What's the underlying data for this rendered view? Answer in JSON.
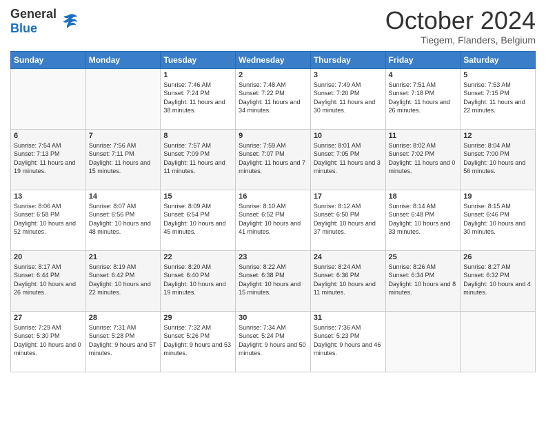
{
  "header": {
    "logo_general": "General",
    "logo_blue": "Blue",
    "title": "October 2024",
    "location": "Tiegem, Flanders, Belgium"
  },
  "weekdays": [
    "Sunday",
    "Monday",
    "Tuesday",
    "Wednesday",
    "Thursday",
    "Friday",
    "Saturday"
  ],
  "weeks": [
    [
      {
        "day": "",
        "sunrise": "",
        "sunset": "",
        "daylight": ""
      },
      {
        "day": "",
        "sunrise": "",
        "sunset": "",
        "daylight": ""
      },
      {
        "day": "1",
        "sunrise": "Sunrise: 7:46 AM",
        "sunset": "Sunset: 7:24 PM",
        "daylight": "Daylight: 11 hours and 38 minutes."
      },
      {
        "day": "2",
        "sunrise": "Sunrise: 7:48 AM",
        "sunset": "Sunset: 7:22 PM",
        "daylight": "Daylight: 11 hours and 34 minutes."
      },
      {
        "day": "3",
        "sunrise": "Sunrise: 7:49 AM",
        "sunset": "Sunset: 7:20 PM",
        "daylight": "Daylight: 11 hours and 30 minutes."
      },
      {
        "day": "4",
        "sunrise": "Sunrise: 7:51 AM",
        "sunset": "Sunset: 7:18 PM",
        "daylight": "Daylight: 11 hours and 26 minutes."
      },
      {
        "day": "5",
        "sunrise": "Sunrise: 7:53 AM",
        "sunset": "Sunset: 7:15 PM",
        "daylight": "Daylight: 11 hours and 22 minutes."
      }
    ],
    [
      {
        "day": "6",
        "sunrise": "Sunrise: 7:54 AM",
        "sunset": "Sunset: 7:13 PM",
        "daylight": "Daylight: 11 hours and 19 minutes."
      },
      {
        "day": "7",
        "sunrise": "Sunrise: 7:56 AM",
        "sunset": "Sunset: 7:11 PM",
        "daylight": "Daylight: 11 hours and 15 minutes."
      },
      {
        "day": "8",
        "sunrise": "Sunrise: 7:57 AM",
        "sunset": "Sunset: 7:09 PM",
        "daylight": "Daylight: 11 hours and 11 minutes."
      },
      {
        "day": "9",
        "sunrise": "Sunrise: 7:59 AM",
        "sunset": "Sunset: 7:07 PM",
        "daylight": "Daylight: 11 hours and 7 minutes."
      },
      {
        "day": "10",
        "sunrise": "Sunrise: 8:01 AM",
        "sunset": "Sunset: 7:05 PM",
        "daylight": "Daylight: 11 hours and 3 minutes."
      },
      {
        "day": "11",
        "sunrise": "Sunrise: 8:02 AM",
        "sunset": "Sunset: 7:02 PM",
        "daylight": "Daylight: 11 hours and 0 minutes."
      },
      {
        "day": "12",
        "sunrise": "Sunrise: 8:04 AM",
        "sunset": "Sunset: 7:00 PM",
        "daylight": "Daylight: 10 hours and 56 minutes."
      }
    ],
    [
      {
        "day": "13",
        "sunrise": "Sunrise: 8:06 AM",
        "sunset": "Sunset: 6:58 PM",
        "daylight": "Daylight: 10 hours and 52 minutes."
      },
      {
        "day": "14",
        "sunrise": "Sunrise: 8:07 AM",
        "sunset": "Sunset: 6:56 PM",
        "daylight": "Daylight: 10 hours and 48 minutes."
      },
      {
        "day": "15",
        "sunrise": "Sunrise: 8:09 AM",
        "sunset": "Sunset: 6:54 PM",
        "daylight": "Daylight: 10 hours and 45 minutes."
      },
      {
        "day": "16",
        "sunrise": "Sunrise: 8:10 AM",
        "sunset": "Sunset: 6:52 PM",
        "daylight": "Daylight: 10 hours and 41 minutes."
      },
      {
        "day": "17",
        "sunrise": "Sunrise: 8:12 AM",
        "sunset": "Sunset: 6:50 PM",
        "daylight": "Daylight: 10 hours and 37 minutes."
      },
      {
        "day": "18",
        "sunrise": "Sunrise: 8:14 AM",
        "sunset": "Sunset: 6:48 PM",
        "daylight": "Daylight: 10 hours and 33 minutes."
      },
      {
        "day": "19",
        "sunrise": "Sunrise: 8:15 AM",
        "sunset": "Sunset: 6:46 PM",
        "daylight": "Daylight: 10 hours and 30 minutes."
      }
    ],
    [
      {
        "day": "20",
        "sunrise": "Sunrise: 8:17 AM",
        "sunset": "Sunset: 6:44 PM",
        "daylight": "Daylight: 10 hours and 26 minutes."
      },
      {
        "day": "21",
        "sunrise": "Sunrise: 8:19 AM",
        "sunset": "Sunset: 6:42 PM",
        "daylight": "Daylight: 10 hours and 22 minutes."
      },
      {
        "day": "22",
        "sunrise": "Sunrise: 8:20 AM",
        "sunset": "Sunset: 6:40 PM",
        "daylight": "Daylight: 10 hours and 19 minutes."
      },
      {
        "day": "23",
        "sunrise": "Sunrise: 8:22 AM",
        "sunset": "Sunset: 6:38 PM",
        "daylight": "Daylight: 10 hours and 15 minutes."
      },
      {
        "day": "24",
        "sunrise": "Sunrise: 8:24 AM",
        "sunset": "Sunset: 6:36 PM",
        "daylight": "Daylight: 10 hours and 11 minutes."
      },
      {
        "day": "25",
        "sunrise": "Sunrise: 8:26 AM",
        "sunset": "Sunset: 6:34 PM",
        "daylight": "Daylight: 10 hours and 8 minutes."
      },
      {
        "day": "26",
        "sunrise": "Sunrise: 8:27 AM",
        "sunset": "Sunset: 6:32 PM",
        "daylight": "Daylight: 10 hours and 4 minutes."
      }
    ],
    [
      {
        "day": "27",
        "sunrise": "Sunrise: 7:29 AM",
        "sunset": "Sunset: 5:30 PM",
        "daylight": "Daylight: 10 hours and 0 minutes."
      },
      {
        "day": "28",
        "sunrise": "Sunrise: 7:31 AM",
        "sunset": "Sunset: 5:28 PM",
        "daylight": "Daylight: 9 hours and 57 minutes."
      },
      {
        "day": "29",
        "sunrise": "Sunrise: 7:32 AM",
        "sunset": "Sunset: 5:26 PM",
        "daylight": "Daylight: 9 hours and 53 minutes."
      },
      {
        "day": "30",
        "sunrise": "Sunrise: 7:34 AM",
        "sunset": "Sunset: 5:24 PM",
        "daylight": "Daylight: 9 hours and 50 minutes."
      },
      {
        "day": "31",
        "sunrise": "Sunrise: 7:36 AM",
        "sunset": "Sunset: 5:23 PM",
        "daylight": "Daylight: 9 hours and 46 minutes."
      },
      {
        "day": "",
        "sunrise": "",
        "sunset": "",
        "daylight": ""
      },
      {
        "day": "",
        "sunrise": "",
        "sunset": "",
        "daylight": ""
      }
    ]
  ]
}
